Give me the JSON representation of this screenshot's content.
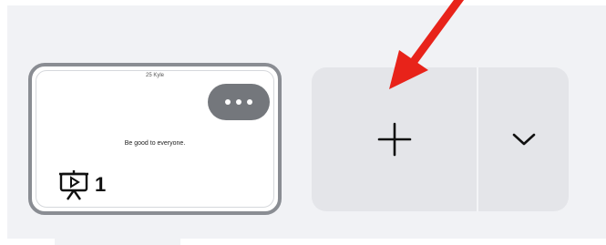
{
  "page_thumbnail": {
    "top_text": "25 Kyle",
    "body_text": "Be good to everyone.",
    "page_number": "1",
    "icon": "presentation-icon"
  },
  "more_button": {
    "icon": "more-dots-icon"
  },
  "add_page_button": {
    "icon": "plus-icon"
  },
  "add_page_options": {
    "icon": "chevron-down-icon"
  },
  "annotation": {
    "icon": "red-arrow-icon",
    "color": "#e8231a"
  },
  "colors": {
    "panel_bg": "#f1f2f5",
    "button_bg": "#e4e5e9",
    "thumb_border": "#8a8d93",
    "more_bg": "#74777c"
  }
}
